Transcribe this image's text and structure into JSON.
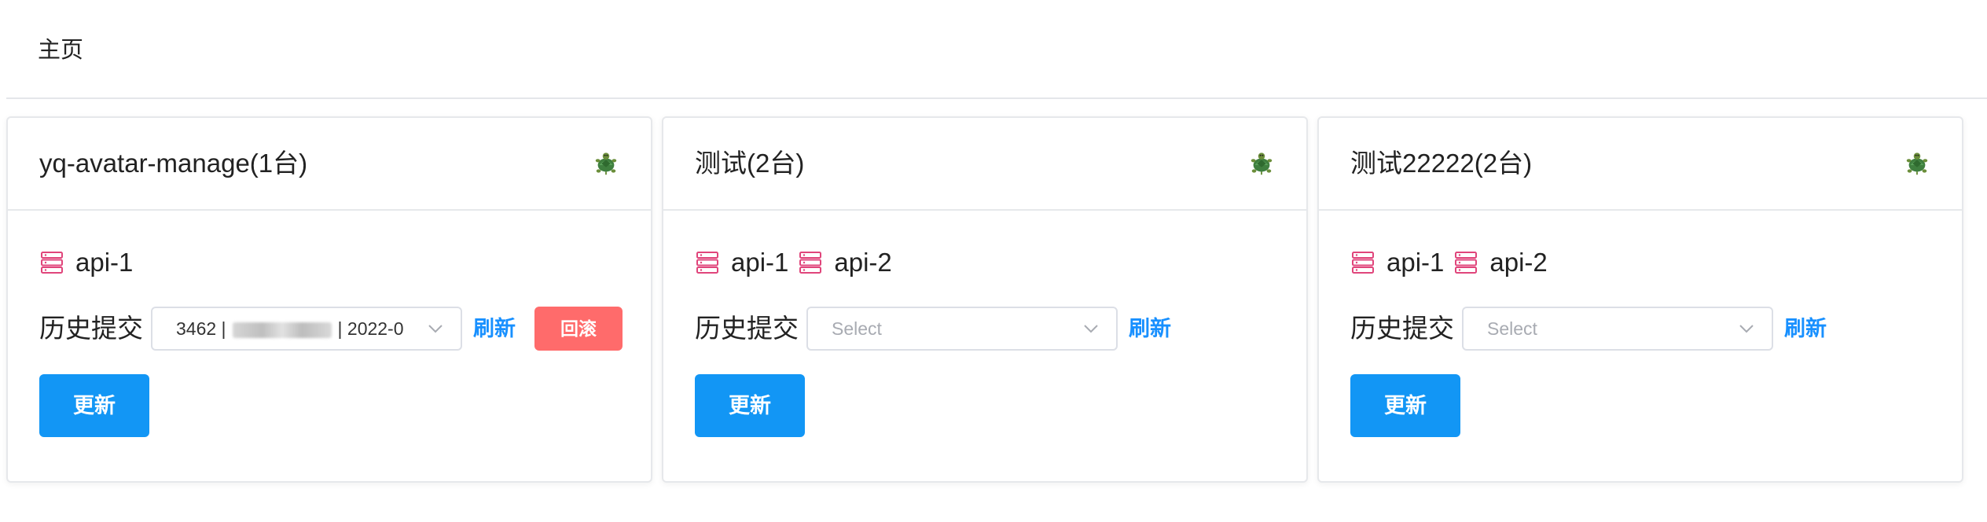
{
  "page": {
    "title": "主页"
  },
  "colors": {
    "primary": "#1296f5",
    "link": "#1890ff",
    "danger": "#ff6b6b",
    "server_icon": "#e0457b"
  },
  "cards": [
    {
      "title": "yq-avatar-manage(1台)",
      "status_icon": "turtle-icon",
      "servers": [
        {
          "label": "api-1",
          "icon": "server-icon"
        }
      ],
      "history_label": "历史提交",
      "select": {
        "value_prefix": "3462 |",
        "value_suffix": "| 2022-0",
        "placeholder": ""
      },
      "refresh_label": "刷新",
      "rollback_label": "回滚",
      "update_label": "更新"
    },
    {
      "title": "测试(2台)",
      "status_icon": "turtle-icon",
      "servers": [
        {
          "label": "api-1",
          "icon": "server-icon"
        },
        {
          "label": "api-2",
          "icon": "server-icon"
        }
      ],
      "history_label": "历史提交",
      "select": {
        "value_prefix": "",
        "value_suffix": "",
        "placeholder": "Select"
      },
      "refresh_label": "刷新",
      "update_label": "更新"
    },
    {
      "title": "测试22222(2台)",
      "status_icon": "turtle-icon",
      "servers": [
        {
          "label": "api-1",
          "icon": "server-icon"
        },
        {
          "label": "api-2",
          "icon": "server-icon"
        }
      ],
      "history_label": "历史提交",
      "select": {
        "value_prefix": "",
        "value_suffix": "",
        "placeholder": "Select"
      },
      "refresh_label": "刷新",
      "update_label": "更新"
    }
  ]
}
